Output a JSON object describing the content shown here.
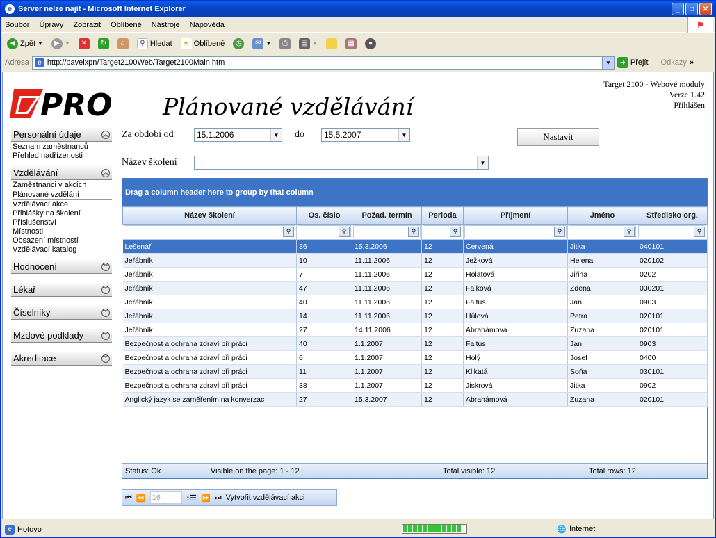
{
  "window": {
    "title": "Server nelze najít - Microsoft Internet Explorer"
  },
  "menu": [
    "Soubor",
    "Úpravy",
    "Zobrazit",
    "Oblíbené",
    "Nástroje",
    "Nápověda"
  ],
  "toolbar": {
    "back": "Zpět",
    "search": "Hledat",
    "favorites": "Oblíbené"
  },
  "address": {
    "label": "Adresa",
    "url": "http://pavelxpn/Target2100Web/Target2100Main.htm",
    "go": "Přejít",
    "links": "Odkazy"
  },
  "page": {
    "logo": "PRO",
    "title": "Plánované vzdělávání",
    "app_name": "Target 2100 - Webové moduly",
    "version": "Verze 1.42",
    "login": "Přihlášen"
  },
  "sidebar": {
    "sections": [
      {
        "label": "Personální údaje",
        "items": [
          "Seznam zaměstnanců",
          "Přehled nadřízenosti"
        ]
      },
      {
        "label": "Vzdělávání",
        "items": [
          "Zaměstnanci v akcích",
          "Plánované vzdělání",
          "Vzdělávací akce",
          "Přihlášky na školení",
          "Příslušenství",
          "Místnosti",
          "Obsazení místností",
          "Vzdělávací katalog"
        ]
      },
      {
        "label": "Hodnocení",
        "items": []
      },
      {
        "label": "Lékař",
        "items": []
      },
      {
        "label": "Číselníky",
        "items": []
      },
      {
        "label": "Mzdové podklady",
        "items": []
      },
      {
        "label": "Akreditace",
        "items": []
      }
    ]
  },
  "filter": {
    "period_label": "Za období od",
    "from": "15.1.2006",
    "to_label": "do",
    "to": "15.5.2007",
    "course_label": "Název školení",
    "course_value": "",
    "set_button": "Nastavit"
  },
  "grid": {
    "group_hint": "Drag a column header here to group by that column",
    "columns": [
      "Název školení",
      "Os. číslo",
      "Požad. termín",
      "Perioda",
      "Příjmení",
      "Jméno",
      "Středisko org."
    ],
    "rows": [
      [
        "Lešenář",
        "36",
        "15.3.2006",
        "12",
        "Červená",
        "Jitka",
        "040101"
      ],
      [
        "Jeřábník",
        "10",
        "11.11.2006",
        "12",
        "Ježková",
        "Helena",
        "020102"
      ],
      [
        "Jeřábník",
        "7",
        "11.11.2006",
        "12",
        "Holatová",
        "Jiřina",
        "0202"
      ],
      [
        "Jeřábník",
        "47",
        "11.11.2006",
        "12",
        "Falková",
        "Zdena",
        "030201"
      ],
      [
        "Jeřábník",
        "40",
        "11.11.2006",
        "12",
        "Faltus",
        "Jan",
        "0903"
      ],
      [
        "Jeřábník",
        "14",
        "11.11.2006",
        "12",
        "Hůlová",
        "Petra",
        "020101"
      ],
      [
        "Jeřábník",
        "27",
        "14.11.2006",
        "12",
        "Abrahámová",
        "Zuzana",
        "020101"
      ],
      [
        "Bezpečnost a ochrana zdraví při práci",
        "40",
        "1.1.2007",
        "12",
        "Faltus",
        "Jan",
        "0903"
      ],
      [
        "Bezpečnost a ochrana zdraví při práci",
        "6",
        "1.1.2007",
        "12",
        "Holý",
        "Josef",
        "0400"
      ],
      [
        "Bezpečnost a ochrana zdraví při práci",
        "11",
        "1.1.2007",
        "12",
        "Klikatá",
        "Soňa",
        "030101"
      ],
      [
        "Bezpečnost a ochrana zdraví při práci",
        "38",
        "1.1.2007",
        "12",
        "Jiskrová",
        "Jitka",
        "0902"
      ],
      [
        "Anglický jazyk se zaměřením na konverzac",
        "27",
        "15.3.2007",
        "12",
        "Abrahámová",
        "Zuzana",
        "020101"
      ]
    ],
    "status": "Status: Ok",
    "visible": "Visible on the page: 1 - 12",
    "total_visible": "Total visible: 12",
    "total_rows": "Total rows: 12"
  },
  "pager": {
    "page": "16",
    "action": "Vytvořit vzdělávací akci"
  },
  "statusbar": {
    "text": "Hotovo",
    "zone": "Internet"
  }
}
